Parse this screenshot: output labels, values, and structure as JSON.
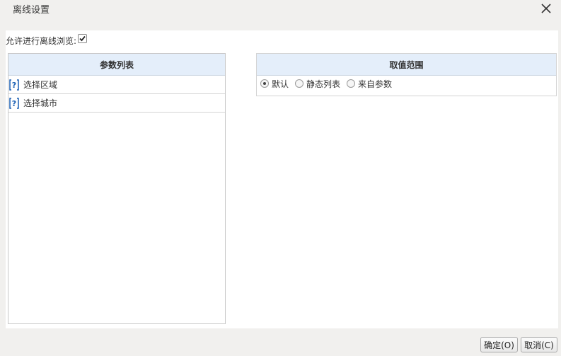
{
  "dialog": {
    "title": "离线设置",
    "close_icon": "close-icon"
  },
  "allow_offline": {
    "label": "允许进行离线浏览:",
    "checked": true
  },
  "param_list": {
    "header": "参数列表",
    "items": [
      {
        "label": "选择区域",
        "icon": "question-icon"
      },
      {
        "label": "选择城市",
        "icon": "question-icon"
      }
    ]
  },
  "value_range": {
    "header": "取值范围",
    "options": [
      {
        "label": "默认",
        "selected": true
      },
      {
        "label": "静态列表",
        "selected": false
      },
      {
        "label": "来自参数",
        "selected": false
      }
    ]
  },
  "buttons": {
    "ok": "确定(O)",
    "cancel": "取消(C)"
  },
  "colors": {
    "header_bg": "#e4eefa",
    "icon_blue": "#1a5fb4"
  }
}
